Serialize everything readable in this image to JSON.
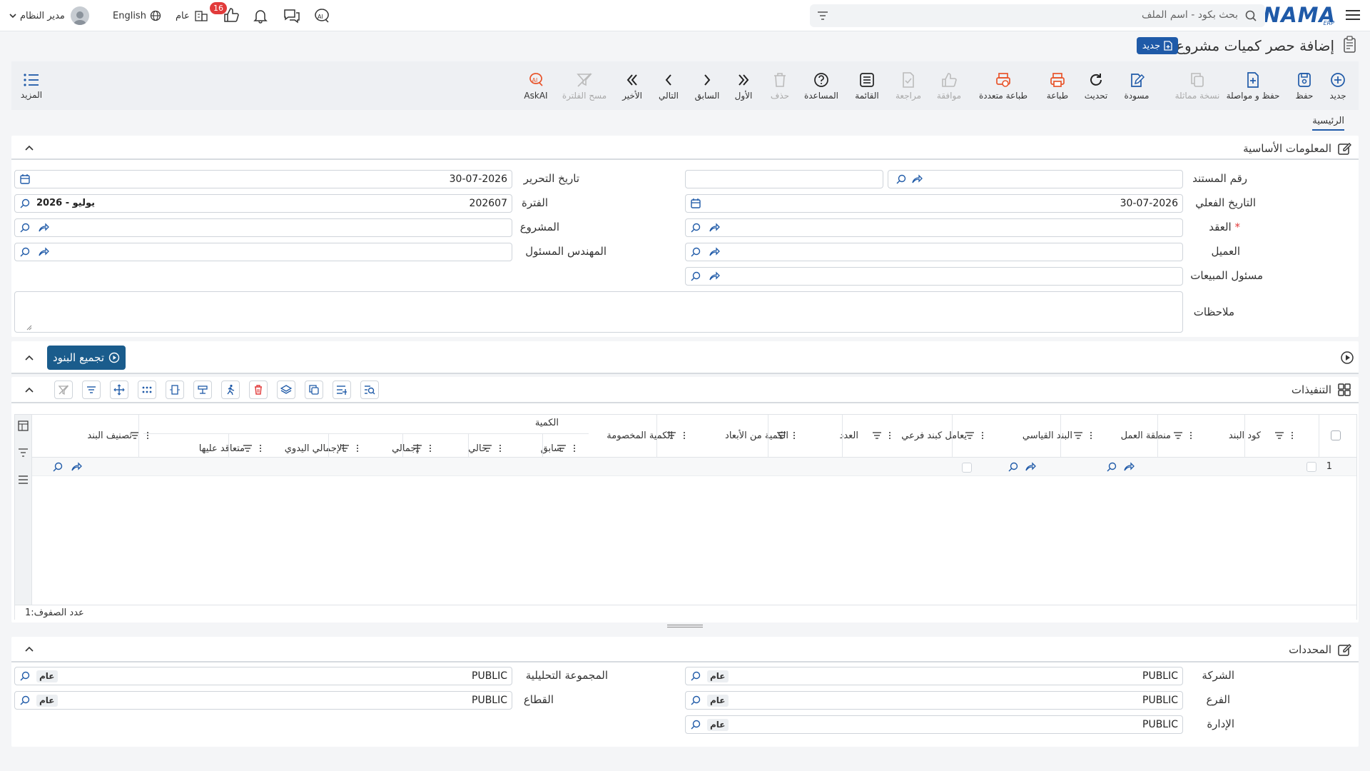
{
  "topbar": {
    "logo": "NAMA",
    "logo_sub": "ERP",
    "search_placeholder": "بحث بكود - اسم الملف",
    "user": "مدير النظام",
    "language": "English",
    "scope": "عام",
    "notification_count": "16"
  },
  "page": {
    "title": "إضافة حصر كميات مشروع",
    "new_badge": "جديد"
  },
  "toolbar": [
    {
      "name": "new",
      "label": "جديد",
      "icon": "plus-circle-icon",
      "enabled": true
    },
    {
      "name": "save",
      "label": "حفظ",
      "icon": "save-icon",
      "enabled": true
    },
    {
      "name": "save-continue",
      "label": "حفظ و مواصلة",
      "icon": "save-add-icon",
      "enabled": true
    },
    {
      "name": "duplicate",
      "label": "نسخة مماثلة",
      "icon": "copy-icon",
      "enabled": false
    },
    {
      "name": "draft",
      "label": "مسودة",
      "icon": "edit-icon",
      "enabled": true
    },
    {
      "name": "refresh",
      "label": "تحديث",
      "icon": "refresh-icon",
      "enabled": true
    },
    {
      "name": "print",
      "label": "طباعة",
      "icon": "printer-icon",
      "enabled": true
    },
    {
      "name": "multi-print",
      "label": "طباعة متعددة",
      "icon": "multi-printer-icon",
      "enabled": true
    },
    {
      "name": "approve",
      "label": "موافقة",
      "icon": "thumbs-up-icon",
      "enabled": false
    },
    {
      "name": "review",
      "label": "مراجعة",
      "icon": "review-icon",
      "enabled": false
    },
    {
      "name": "list",
      "label": "القائمة",
      "icon": "list-icon",
      "enabled": true
    },
    {
      "name": "help",
      "label": "المساعدة",
      "icon": "help-icon",
      "enabled": true
    },
    {
      "name": "delete",
      "label": "حذف",
      "icon": "trash-icon",
      "enabled": false
    },
    {
      "name": "first",
      "label": "الأول",
      "icon": "double-chevron-right-icon",
      "enabled": true
    },
    {
      "name": "prev",
      "label": "السابق",
      "icon": "chevron-right-icon",
      "enabled": true
    },
    {
      "name": "next",
      "label": "التالي",
      "icon": "chevron-left-icon",
      "enabled": true
    },
    {
      "name": "last",
      "label": "الأخير",
      "icon": "double-chevron-left-icon",
      "enabled": true
    },
    {
      "name": "clear-filter",
      "label": "مسح الفلترة",
      "icon": "filter-clear-icon",
      "enabled": false
    },
    {
      "name": "askai",
      "label": "AskAI",
      "icon": "ai-icon",
      "enabled": true
    }
  ],
  "toolbar_more": "المزيد",
  "tabs": {
    "main": "الرئيسية"
  },
  "basic_info": {
    "title": "المعلومات الأساسية",
    "doc_number": {
      "label": "رقم المستند",
      "value": ""
    },
    "edit_date": {
      "label": "تاريخ التحرير",
      "value": "30-07-2026"
    },
    "actual_date": {
      "label": "التاريخ الفعلي",
      "value": "30-07-2026"
    },
    "period": {
      "label": "الفترة",
      "value": "202607",
      "extra": "2026 - يوليو"
    },
    "contract": {
      "label": "العقد",
      "value": "",
      "required": "*"
    },
    "project": {
      "label": "المشروع",
      "value": ""
    },
    "customer": {
      "label": "العميل",
      "value": ""
    },
    "engineer": {
      "label": "المهندس المسئول",
      "value": ""
    },
    "sales": {
      "label": "مسئول المبيعات",
      "value": ""
    },
    "notes": {
      "label": "ملاحظات",
      "value": ""
    }
  },
  "group_items": {
    "label": "تجميع البنود"
  },
  "executions": {
    "title": "التنفيذات",
    "columns": [
      "كود البند",
      "منطقة العمل",
      "البند القياسي",
      "يعامل كبند فرعي",
      "العدد",
      "الكمية من الأبعاد",
      "الكمية المخصومة"
    ],
    "quantity_group": "الكمية",
    "quantity_cols": [
      "سابق",
      "حالي",
      "إجمالي",
      "الإجمالي اليدوي",
      "متعاقد عليها"
    ],
    "last_col": "تصنيف البند",
    "row_number": "1",
    "row_count_label": "عدد الصفوف:",
    "row_count": "1"
  },
  "dimensions": {
    "title": "المحددات",
    "company": {
      "label": "الشركة",
      "value": "PUBLIC",
      "chip": "عام"
    },
    "branch": {
      "label": "الفرع",
      "value": "PUBLIC",
      "chip": "عام"
    },
    "department": {
      "label": "الإدارة",
      "value": "PUBLIC",
      "chip": "عام"
    },
    "analytic_group": {
      "label": "المجموعة التحليلية",
      "value": "PUBLIC",
      "chip": "عام"
    },
    "sector": {
      "label": "القطاع",
      "value": "PUBLIC",
      "chip": "عام"
    }
  },
  "colors": {
    "accent": "#1f5aa8",
    "orange": "#e8542b",
    "danger": "#e23b3b"
  }
}
